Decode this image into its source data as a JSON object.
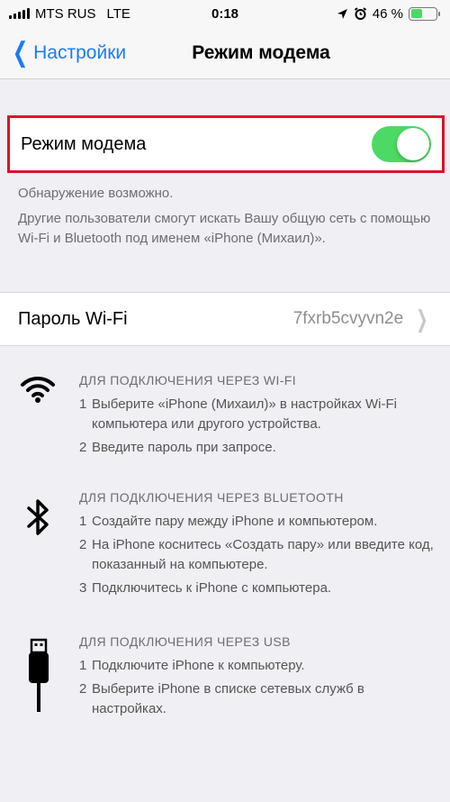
{
  "status": {
    "carrier": "MTS RUS",
    "network": "LTE",
    "time": "0:18",
    "battery_percent": "46 %",
    "battery_level": 0.46
  },
  "nav": {
    "back_label": "Настройки",
    "title": "Режим модема"
  },
  "hotspot": {
    "label": "Режим модема",
    "enabled": true,
    "footer_line1": "Обнаружение возможно.",
    "footer_line2": "Другие пользователи смогут искать Вашу общую сеть с помощью Wi-Fi и Bluetooth под именем «iPhone (Михаил)»."
  },
  "password": {
    "label": "Пароль Wi-Fi",
    "value": "7fxrb5cvyvn2e"
  },
  "instructions": {
    "wifi": {
      "heading": "ДЛЯ ПОДКЛЮЧЕНИЯ ЧЕРЕЗ WI-FI",
      "steps": [
        {
          "num": "1",
          "text": "Выберите «iPhone (Михаил)» в настройках Wi-Fi компьютера или другого устройства."
        },
        {
          "num": "2",
          "text": "Введите пароль при запросе."
        }
      ]
    },
    "bluetooth": {
      "heading": "ДЛЯ ПОДКЛЮЧЕНИЯ ЧЕРЕЗ BLUETOOTH",
      "steps": [
        {
          "num": "1",
          "text": "Создайте пару между iPhone и компьютером."
        },
        {
          "num": "2",
          "text": "На iPhone коснитесь «Создать пару» или введите код, показанный на компьютере."
        },
        {
          "num": "3",
          "text": "Подключитесь к iPhone с компьютера."
        }
      ]
    },
    "usb": {
      "heading": "ДЛЯ ПОДКЛЮЧЕНИЯ ЧЕРЕЗ USB",
      "steps": [
        {
          "num": "1",
          "text": "Подключите iPhone к компьютеру."
        },
        {
          "num": "2",
          "text": "Выберите iPhone в списке сетевых служб в настройках."
        }
      ]
    }
  },
  "colors": {
    "accent": "#1a7cf5",
    "switch_on": "#4cd964",
    "highlight_border": "#e0102a"
  }
}
